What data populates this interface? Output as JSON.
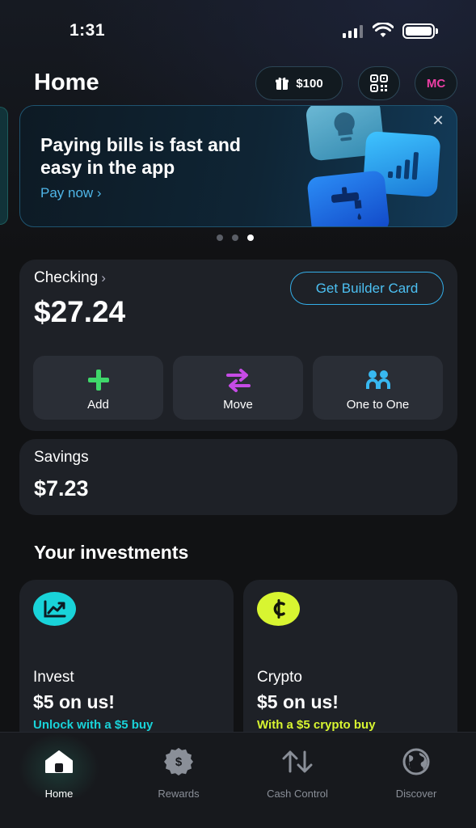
{
  "status_bar": {
    "time": "1:31"
  },
  "header": {
    "title": "Home",
    "reward_amount": "$100",
    "avatar_initials": "MC"
  },
  "promo": {
    "title": "Paying bills is fast and easy in the app",
    "cta": "Pay now ›",
    "close": "✕",
    "page_count": 3,
    "active_page": 3
  },
  "checking": {
    "label": "Checking",
    "chevron": "›",
    "balance": "$27.24",
    "builder_button": "Get Builder Card",
    "actions": [
      {
        "label": "Add",
        "icon": "plus-icon",
        "color": "#3fd86a"
      },
      {
        "label": "Move",
        "icon": "swap-arrows-icon",
        "color": "#c64be6"
      },
      {
        "label": "One to One",
        "icon": "people-icon",
        "color": "#38b8f0"
      }
    ]
  },
  "savings": {
    "label": "Savings",
    "balance": "$7.23"
  },
  "investments": {
    "title": "Your investments",
    "cards": [
      {
        "name": "Invest",
        "offer": "$5 on us!",
        "sub": "Unlock with a $5 buy",
        "icon": "chart-up-icon",
        "accent": "#19d3d9"
      },
      {
        "name": "Crypto",
        "offer": "$5 on us!",
        "sub": "With a $5 crypto buy",
        "icon": "cent-icon",
        "accent": "#d8f531"
      }
    ]
  },
  "nav": {
    "items": [
      {
        "label": "Home",
        "icon": "home-icon",
        "active": true
      },
      {
        "label": "Rewards",
        "icon": "dollar-badge-icon",
        "active": false
      },
      {
        "label": "Cash Control",
        "icon": "up-down-arrows-icon",
        "active": false
      },
      {
        "label": "Discover",
        "icon": "globe-icon",
        "active": false
      }
    ]
  }
}
